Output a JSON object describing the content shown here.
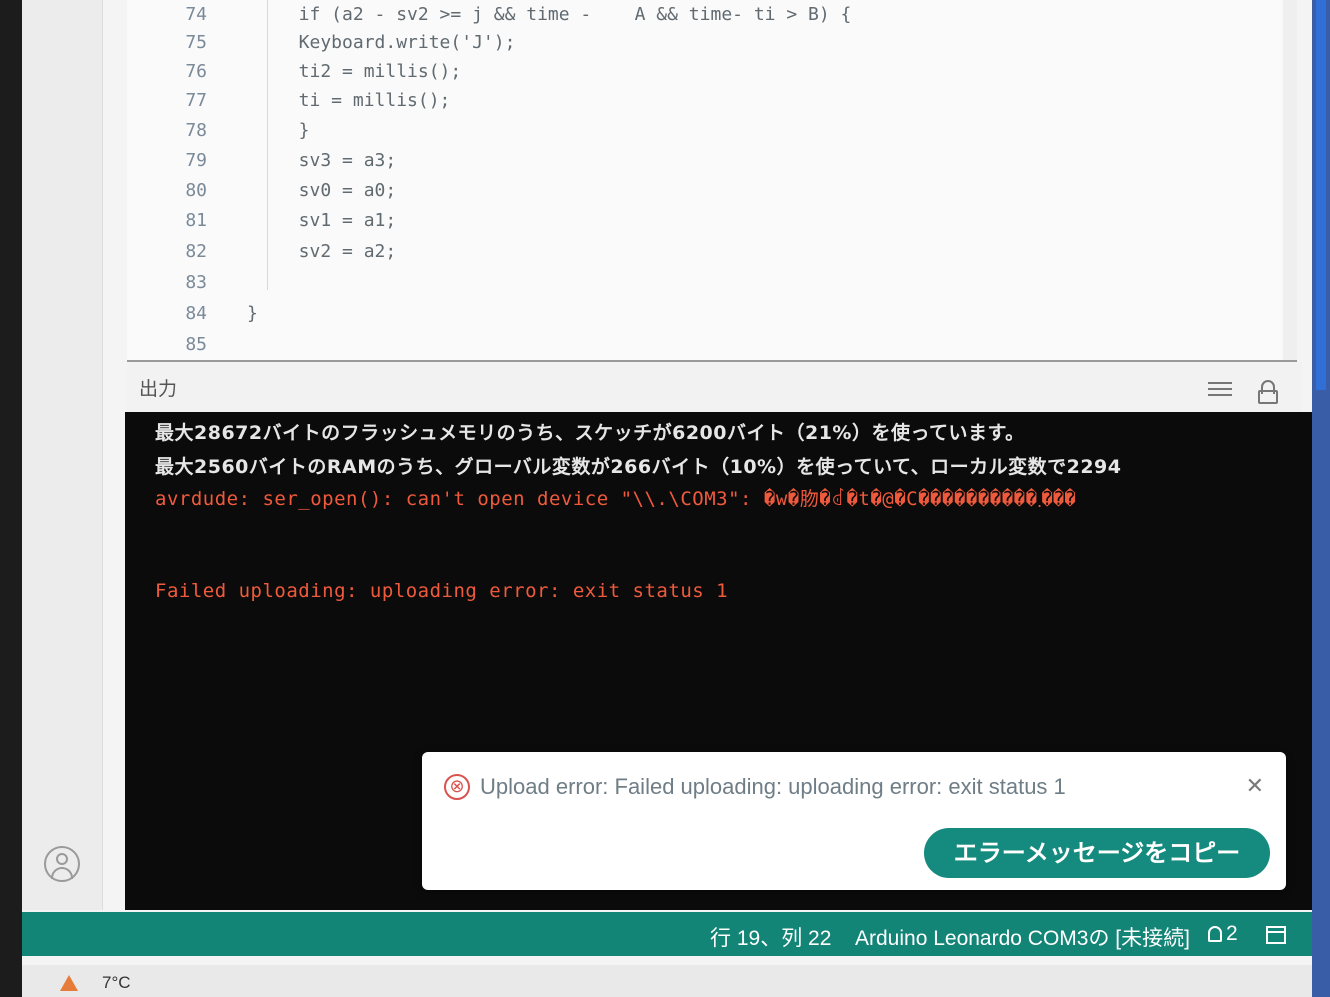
{
  "editor": {
    "lines": [
      {
        "num": "74",
        "code": "  if (a2 - sv2 >= j && time -    A && time- ti > B) {"
      },
      {
        "num": "75",
        "code": "  Keyboard.write('J');"
      },
      {
        "num": "76",
        "code": "  ti2 = millis();"
      },
      {
        "num": "77",
        "code": "  ti = millis();"
      },
      {
        "num": "78",
        "code": "  }"
      },
      {
        "num": "79",
        "code": "  sv3 = a3;"
      },
      {
        "num": "80",
        "code": "  sv0 = a0;"
      },
      {
        "num": "81",
        "code": "  sv1 = a1;"
      },
      {
        "num": "82",
        "code": "  sv2 = a2;"
      },
      {
        "num": "83",
        "code": ""
      },
      {
        "num": "84",
        "code": "}"
      },
      {
        "num": "85",
        "code": ""
      }
    ]
  },
  "output": {
    "title": "出力",
    "lines": [
      "最大28672バイトのフラッシュメモリのうち、スケッチが6200バイト（21%）を使っています。",
      "最大2560バイトのRAMのうち、グローバル変数が266バイト（10%）を使っていて、ローカル変数で2294",
      "avrdude: ser_open(): can't open device \"\\\\.\\COM3\": �w�肳�ꂽ�t�@�C����������܂���",
      "Failed uploading: uploading error: exit status 1"
    ]
  },
  "toast": {
    "message": "Upload error: Failed uploading: uploading error: exit status 1",
    "error_icon": "⊗",
    "close_icon": "✕",
    "copy_button": "エラーメッセージをコピー"
  },
  "statusbar": {
    "cursor_position": "行 19、列 22",
    "board": "Arduino Leonardo COM3の [未接続]",
    "notifications": "2"
  },
  "taskbar": {
    "temperature": "7°C"
  },
  "colors": {
    "status_bar": "#138577",
    "error_text": "#f05a3c",
    "copy_button": "#158a7e"
  }
}
